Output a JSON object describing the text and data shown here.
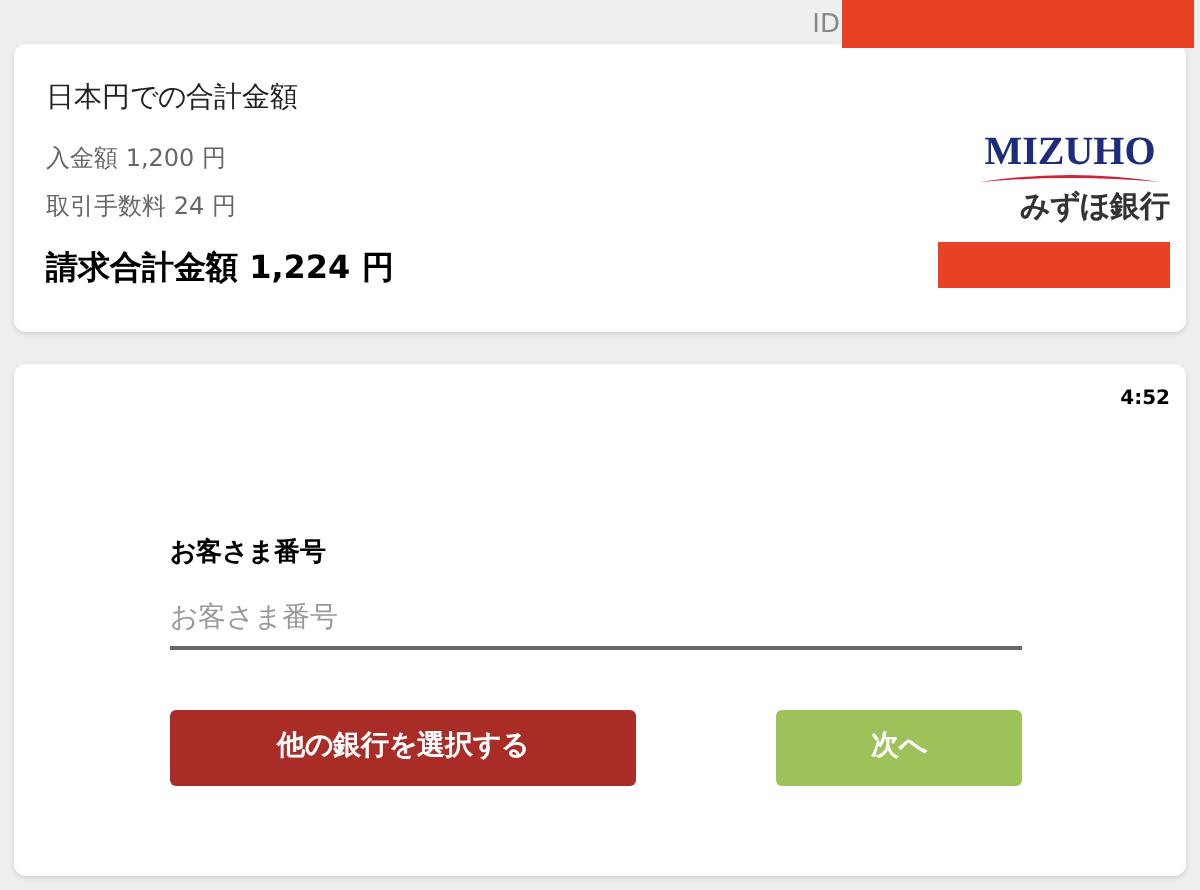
{
  "header": {
    "id_label": "ID"
  },
  "summary": {
    "title": "日本円での合計金額",
    "lines": [
      "入金額 1,200 円",
      "取引手数料 24 円"
    ],
    "total": "請求合計金額 1,224 円",
    "bank_logo": {
      "wordmark": "MIZUHO",
      "name": "みずほ銀行"
    }
  },
  "form": {
    "timer": "4:52",
    "label": "お客さま番号",
    "placeholder": "お客さま番号",
    "buttons": [
      {
        "label": "他の銀行を選択する",
        "kind": "secondary"
      },
      {
        "label": "次へ",
        "kind": "primary"
      }
    ]
  }
}
